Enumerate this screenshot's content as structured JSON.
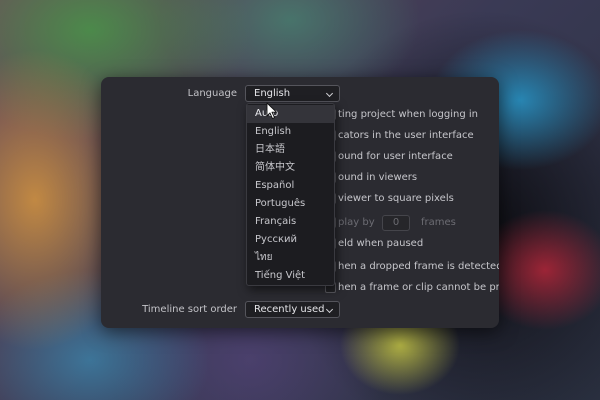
{
  "settings": {
    "language_label": "Language",
    "language_value": "English",
    "timeline_sort_label": "Timeline sort order",
    "timeline_sort_value": "Recently used",
    "options": [
      "ting project when logging in",
      "cators in the user interface",
      "ound for user interface",
      "ound in viewers",
      "viewer to square pixels",
      "play by",
      "eld when paused",
      "hen a dropped frame is detected",
      "hen a frame or clip cannot be proce"
    ],
    "delay_value": "0",
    "delay_unit": "frames"
  },
  "language_dropdown": {
    "highlighted_index": 0,
    "items": [
      "Auto",
      "English",
      "日本語",
      "简体中文",
      "Español",
      "Português",
      "Français",
      "Русский",
      "ไทย",
      "Tiếng Việt"
    ]
  },
  "colors": {
    "panel_bg": "#2b2b31",
    "dropdown_bg": "#1c1c20",
    "highlight_bg": "#34343a",
    "text": "#c9c9cd"
  },
  "icons": {
    "combo_arrow": "chevron-down-icon",
    "pointer": "mouse-cursor-icon"
  }
}
